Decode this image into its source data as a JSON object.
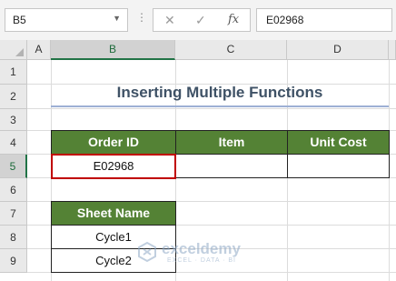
{
  "formula_bar": {
    "name_box": "B5",
    "cancel_icon": "✕",
    "enter_icon": "✓",
    "fx_label": "fx",
    "formula": "E02968"
  },
  "columns": [
    "A",
    "B",
    "C",
    "D"
  ],
  "rows": [
    "1",
    "2",
    "3",
    "4",
    "5",
    "6",
    "7",
    "8",
    "9"
  ],
  "selection": {
    "cell": "B5",
    "column": "B",
    "row": "5"
  },
  "title": "Inserting Multiple Functions",
  "order_table": {
    "headers": [
      "Order ID",
      "Item",
      "Unit Cost"
    ],
    "row": [
      "E02968",
      "",
      ""
    ]
  },
  "sheet_table": {
    "header": "Sheet Name",
    "rows": [
      "Cycle1",
      "Cycle2"
    ]
  },
  "watermark": {
    "name": "exceldemy",
    "tagline": "EXCEL · DATA · BI"
  },
  "colors": {
    "header_green": "#548235",
    "selection_green": "#217346",
    "active_border": "#c00000",
    "title": "#3f5266"
  }
}
